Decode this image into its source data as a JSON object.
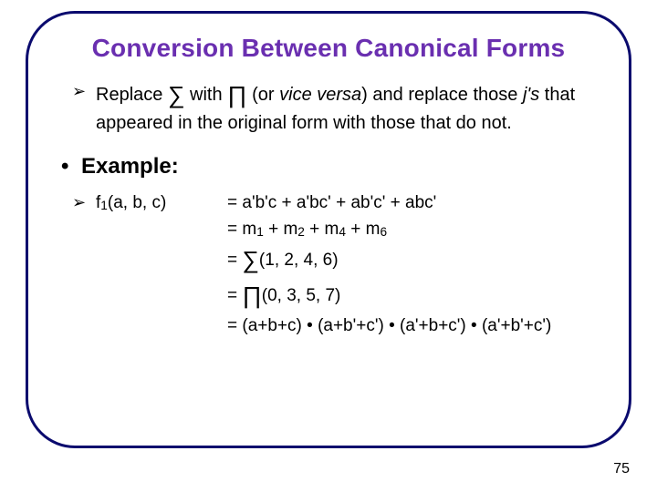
{
  "title": "Conversion Between Canonical Forms",
  "rule": {
    "pre": "Replace ",
    "sym1": "∑",
    "mid1": " with ",
    "sym2": "∏",
    "mid2": " (or ",
    "vice": "vice versa",
    "mid3": ") and replace those ",
    "js": "j's",
    "tail": " that appeared in the original form with those that do not."
  },
  "example_label": "Example:",
  "eq": {
    "lhs_pre": "f",
    "lhs_sub": "1",
    "lhs_args": "(a, b, c)",
    "eq": "= ",
    "r1": "a'b'c + a'bc' + ab'c' + abc'",
    "r2_pre": "m",
    "r2_s1": "1",
    "r2_plus": " + m",
    "r2_s2": "2",
    "r2_s3": "4",
    "r2_s4": "6",
    "r3_sym": "∑",
    "r3_args": "(1, 2, 4, 6)",
    "r4_sym": "∏",
    "r4_args": "(0, 3, 5, 7)",
    "r5": "(a+b+c) • (a+b'+c') • (a'+b+c') • (a'+b'+c')"
  },
  "page": "75"
}
